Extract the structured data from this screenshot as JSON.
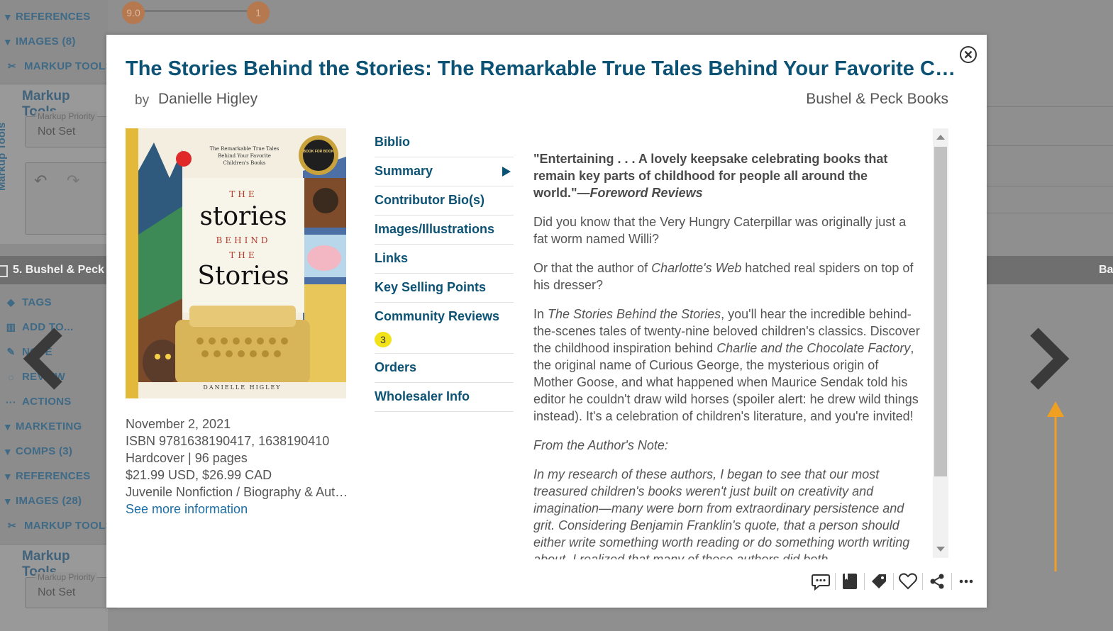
{
  "background": {
    "sidebar_top": [
      {
        "icon": "triangle-down",
        "label": "REFERENCES"
      },
      {
        "icon": "triangle-down",
        "label": "IMAGES (8)"
      },
      {
        "icon": "tools",
        "label": "MARKUP TOOLS"
      }
    ],
    "panel_top": {
      "title": "Markup Tools",
      "vertical": "Markup Tools",
      "field_label": "Markup Priority",
      "field_value": "Not Set"
    },
    "band": {
      "title": "5. Bushel & Peck",
      "right": "Ba"
    },
    "sidebar_bottom": [
      {
        "icon": "tag",
        "label": "TAGS"
      },
      {
        "icon": "bars",
        "label": "ADD TO..."
      },
      {
        "icon": "pencil",
        "label": "NOTE"
      },
      {
        "icon": "speech",
        "label": "REVIEW"
      },
      {
        "icon": "dots",
        "label": "ACTIONS"
      },
      {
        "icon": "triangle-down",
        "label": "MARKETING"
      },
      {
        "icon": "triangle-down",
        "label": "COMPS (3)"
      },
      {
        "icon": "triangle-down",
        "label": "REFERENCES"
      },
      {
        "icon": "triangle-down",
        "label": "IMAGES (28)"
      },
      {
        "icon": "tools",
        "label": "MARKUP TOOLS"
      }
    ],
    "panel_bottom": {
      "title": "Markup Tools",
      "vertical": "Markup Tools",
      "field_label": "Markup Priority",
      "field_value": "Not Set"
    },
    "badges": [
      "9.0",
      "1"
    ]
  },
  "modal": {
    "title": "The Stories Behind the Stories: The Remarkable True Tales Behind Your Favorite Children's Books",
    "by_label": "by",
    "author": "Danielle Higley",
    "publisher": "Bushel & Peck Books",
    "cover": {
      "top_text_1": "The Remarkable True Tales",
      "top_text_2": "Behind Your Favorite",
      "top_text_3": "Children's Books",
      "the": "THE",
      "stories1": "stories",
      "behind": "BEHIND",
      "the2": "THE",
      "stories2": "Stories",
      "author_caps": "DANIELLE HIGLEY",
      "seal": "BOOK FOR BOOK"
    },
    "meta": {
      "date": "November 2, 2021",
      "isbn": "ISBN 9781638190417, 1638190410",
      "format": "Hardcover | 96 pages",
      "price": "$21.99 USD, $26.99 CAD",
      "category": "Juvenile Nonfiction / Biography & Autobiography / Literary",
      "see_more": "See more information"
    },
    "nav": [
      {
        "label": "Biblio"
      },
      {
        "label": "Summary",
        "active": true
      },
      {
        "label": "Contributor Bio(s)"
      },
      {
        "label": "Images/Illustrations"
      },
      {
        "label": "Links"
      },
      {
        "label": "Key Selling Points"
      },
      {
        "label": "Community Reviews",
        "count": "3"
      },
      {
        "label": "Orders"
      },
      {
        "label": "Wholesaler Info"
      }
    ],
    "summary": {
      "quote": "\"Entertaining . . . A lovely keepsake celebrating books that remain key parts of childhood for people all around the world.\"",
      "quote_source_dash": "—",
      "quote_source": "Foreword Reviews",
      "p1": "Did you know that the Very Hungry Caterpillar was originally just a fat worm named Willi?",
      "p2_a": "Or that the author of ",
      "p2_i": "Charlotte's Web",
      "p2_b": " hatched real spiders on top of his dresser?",
      "p3_a": "In ",
      "p3_i1": "The Stories Behind the Stories",
      "p3_b": ", you'll hear the incredible behind-the-scenes tales of twenty-nine beloved children's classics. Discover the childhood inspiration behind ",
      "p3_i2": "Charlie and the Chocolate Factory",
      "p3_c": ", the original name of Curious George, the mysterious origin of Mother Goose, and what happened when Maurice Sendak told his editor he couldn't draw wild horses (spoiler alert: he drew wild things instead). It's a celebration of children's literature, and you're invited!",
      "p4": "From the Author's Note:",
      "p5": "In my research of these authors, I began to see that our most treasured children's books weren't just built on creativity and imagination—many were born from extraordinary persistence and grit. Considering Benjamin Franklin's quote, that a person should either write something worth reading or do something worth writing about, I realized that many of these authors did both."
    },
    "actions": [
      "comment-icon",
      "book-icon",
      "tag-icon",
      "heart-icon",
      "share-icon",
      "more-icon"
    ]
  }
}
